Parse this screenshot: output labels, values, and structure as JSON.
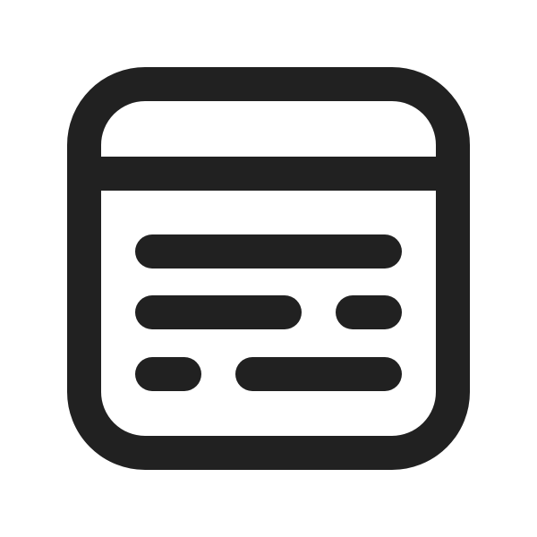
{
  "icon": {
    "name": "text-window-icon",
    "stroke_color": "#212121",
    "background_color": "#ffffff"
  }
}
